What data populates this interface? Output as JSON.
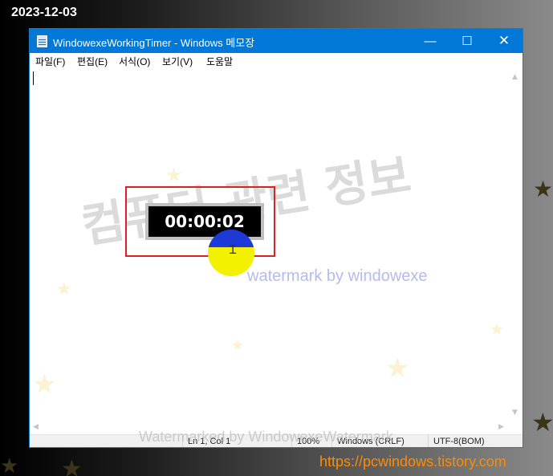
{
  "screenshot_date": "2023-12-03",
  "window": {
    "title": "WindowexeWorkingTimer - Windows 메모장",
    "controls": {
      "minimize": "—",
      "maximize": "☐",
      "close": "✕"
    }
  },
  "menu": [
    {
      "label": "파일(F)"
    },
    {
      "label": "편집(E)"
    },
    {
      "label": "서식(O)"
    },
    {
      "label": "보기(V)"
    },
    {
      "label": "도움말"
    }
  ],
  "statusbar": {
    "position": "Ln 1, Col 1",
    "zoom": "100%",
    "line_ending": "Windows (CRLF)",
    "encoding": "UTF-8(BOM)"
  },
  "timer": {
    "display": "00:00:02"
  },
  "overlays": {
    "watermark_korean": "컴퓨터 관련 정보",
    "watermark_english": "watermark by windowexe",
    "watermark_bottom": "Watermarked by WindowexeWatermark",
    "site_url": "https://pcwindows.tistory.com"
  },
  "colors": {
    "titlebar": "#0078d7",
    "highlight_frame": "#e02020",
    "cursor_top": "#1e3ad6",
    "cursor_bottom": "#f3f000",
    "url_text": "#ff8c00"
  },
  "icons": {
    "app": "notepad-icon",
    "cursor": "text-cursor-icon"
  }
}
